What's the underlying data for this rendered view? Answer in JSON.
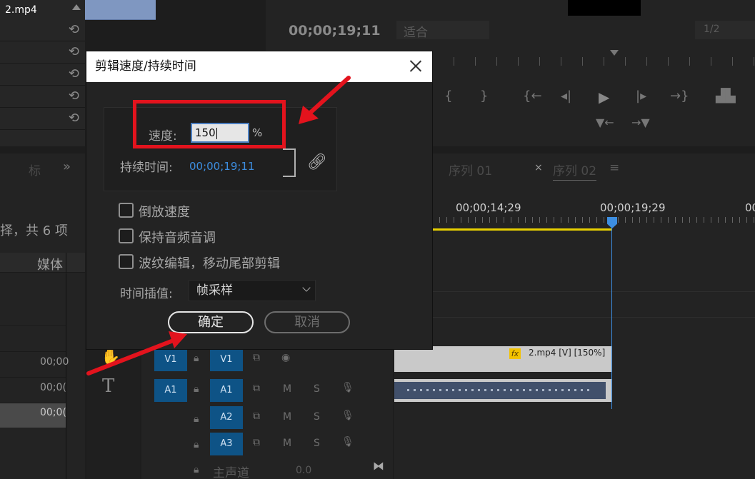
{
  "source": {
    "clip_name": "2.mp4"
  },
  "program_monitor": {
    "timecode": "00;00;19;11",
    "fit_label": "适合",
    "resolution": "1/2"
  },
  "project_panel": {
    "item_count_text": "择，共 6 项",
    "column_header": "媒体",
    "rows": [
      "00;00",
      "00;0(",
      "00;0("
    ]
  },
  "timeline": {
    "tabs": [
      "序列 01",
      "序列 02"
    ],
    "ruler": [
      "00;00;14;29",
      "00;00;19;29",
      "00"
    ],
    "clip_label": "2.mp4 [V] [150%]",
    "fx_badge": "fx",
    "tracks": {
      "v1_src": "V1",
      "v1": "V1",
      "a1_src": "A1",
      "a1": "A1",
      "a2": "A2",
      "a3": "A3",
      "master": "主声道",
      "master_value": "0.0",
      "m": "M",
      "s": "S"
    }
  },
  "dialog": {
    "title": "剪辑速度/持续时间",
    "speed_label": "速度:",
    "speed_value": "150",
    "speed_unit": "%",
    "duration_label": "持续时间:",
    "duration_value": "00;00;19;11",
    "reverse_speed": "倒放速度",
    "maintain_pitch": "保持音频音调",
    "ripple_edit": "波纹编辑，移动尾部剪辑",
    "interp_label": "时间插值:",
    "interp_value": "帧采样",
    "ok_label": "确定",
    "cancel_label": "取消"
  },
  "colors": {
    "annotation_red": "#e3131d",
    "track_blue": "#0e5386",
    "playhead_blue": "#3d8ee0",
    "work_area_yellow": "#e8d000"
  }
}
